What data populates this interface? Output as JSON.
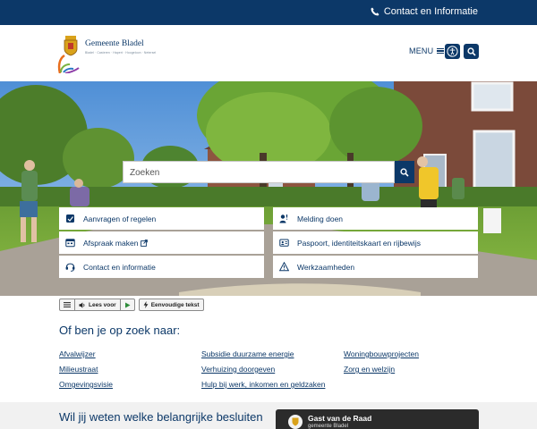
{
  "topbar": {
    "contact_label": "Contact en Informatie"
  },
  "header": {
    "logo_name": "Gemeente Bladel",
    "logo_tagline": "Bladel · Casteren · Hapert · Hoogeloon · Netersel",
    "menu_label": "MENU"
  },
  "hero": {
    "search": {
      "placeholder": "Zoeken"
    },
    "tiles": [
      {
        "label": "Aanvragen of regelen",
        "icon": "form-icon"
      },
      {
        "label": "Melding doen",
        "icon": "report-icon"
      },
      {
        "label": "Afspraak maken",
        "icon": "calendar-icon",
        "external": true
      },
      {
        "label": "Paspoort, identiteitskaart en rijbewijs",
        "icon": "id-card-icon"
      },
      {
        "label": "Contact en informatie",
        "icon": "headset-icon"
      },
      {
        "label": "Werkzaamheden",
        "icon": "warning-icon"
      }
    ]
  },
  "toolbar": {
    "read_label": "Lees voor",
    "simple_label": "Eenvoudige tekst"
  },
  "looking_for": {
    "title": "Of ben je op zoek naar:",
    "links": [
      "Afvalwijzer",
      "Milieustraat",
      "Omgevingsvisie",
      "Subsidie duurzame energie",
      "Verhuizing doorgeven",
      "Hulp bij werk, inkomen en geldzaken",
      "Woningbouwprojecten",
      "Zorg en welzijn"
    ]
  },
  "bottom": {
    "title": "Wil jij weten welke belangrijke besluiten",
    "video_title": "Gast van de Raad",
    "video_channel": "gemeente Bladel"
  },
  "colors": {
    "primary": "#0c3868",
    "accent": "#e86e1e",
    "muted_bg": "#f1f1f1"
  }
}
